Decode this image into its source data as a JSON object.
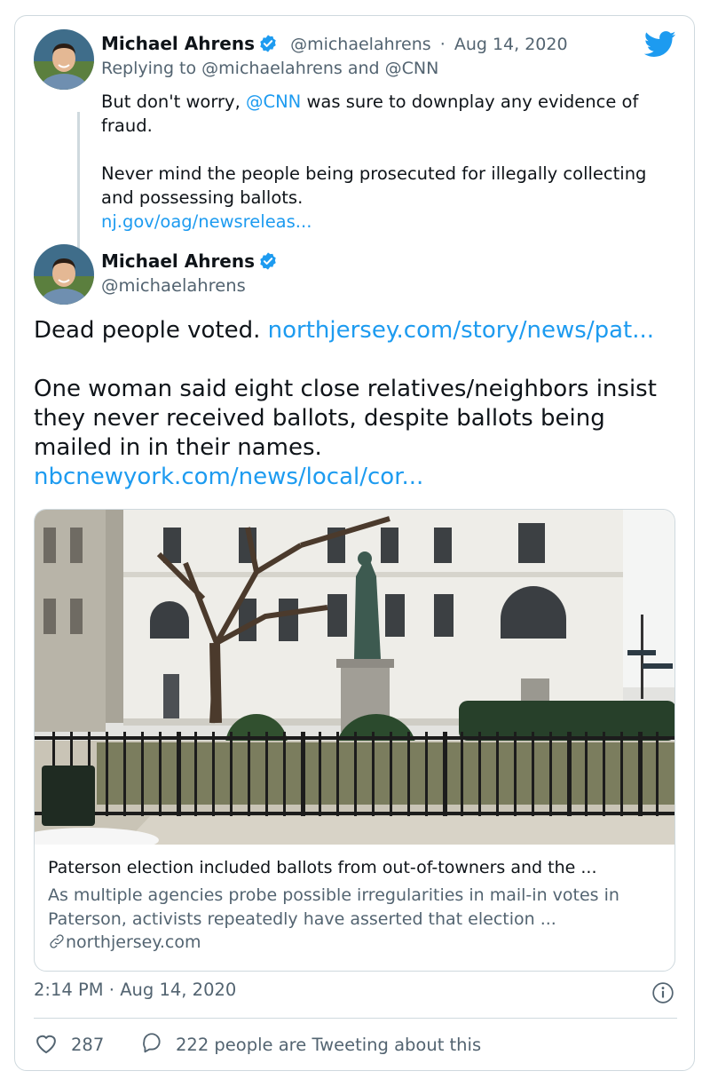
{
  "reply_tweet": {
    "author_name": "Michael Ahrens",
    "handle": "@michaelahrens",
    "separator": "·",
    "date": "Aug 14, 2020",
    "replying_prefix": "Replying to",
    "replying_user_1": "@michaelahrens",
    "replying_and": "and",
    "replying_user_2": "@CNN",
    "text_part1": "But don't worry,",
    "mention": "@CNN",
    "text_part2": "was sure to downplay any evidence of fraud.",
    "text_para2": "Never mind the people being prosecuted for illegally collecting and possessing ballots.",
    "link": "nj.gov/oag/newsreleas..."
  },
  "main_tweet": {
    "author_name": "Michael Ahrens",
    "handle": "@michaelahrens",
    "line1_text": "Dead people voted.",
    "line1_link": "northjersey.com/story/news/pat...",
    "para2": "One woman said eight close relatives/neighbors insist they never received ballots, despite ballots being mailed in in their names.",
    "link2": "nbcnewyork.com/news/local/cor..."
  },
  "link_card": {
    "title": "Paterson election included ballots from out-of-towners and the ...",
    "description": "As multiple agencies probe possible irregularities in mail-in votes in Paterson, activists repeatedly have asserted that election ...",
    "domain": "northjersey.com"
  },
  "footer": {
    "time": "2:14 PM",
    "separator": "·",
    "date": "Aug 14, 2020",
    "likes": "287",
    "tweeting_text": "222 people are Tweeting about this"
  },
  "colors": {
    "link": "#1d9bf0",
    "muted": "#536471",
    "border": "#cfd9de",
    "twitter_blue": "#1d9bf0"
  },
  "icons": [
    "twitter-bird-icon",
    "verified-badge-icon",
    "link-chain-icon",
    "info-icon",
    "heart-icon",
    "speech-bubble-icon"
  ]
}
